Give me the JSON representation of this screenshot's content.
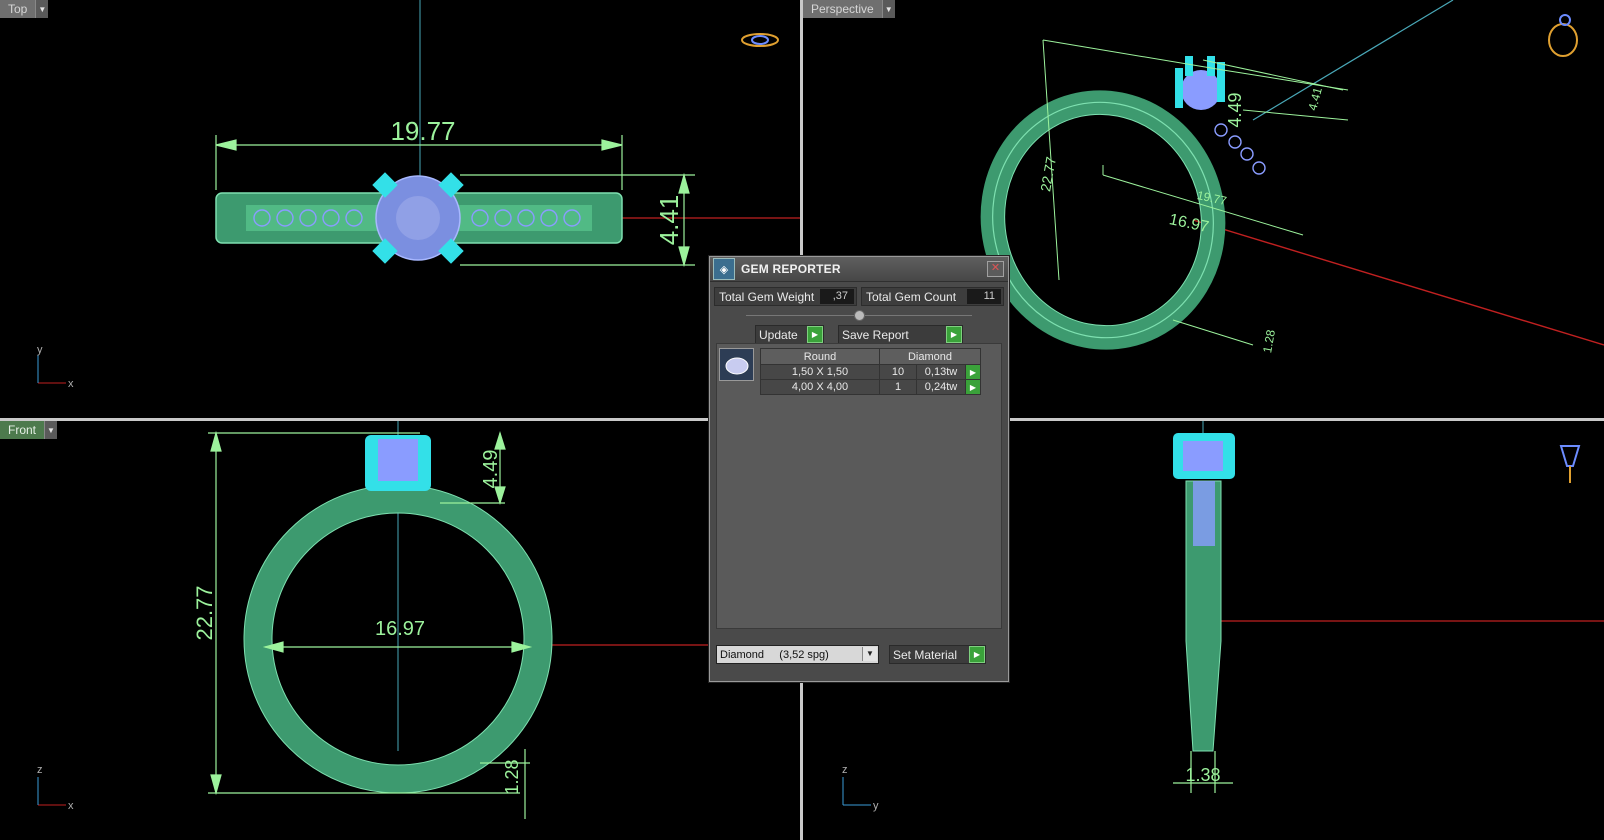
{
  "viewports": {
    "top": {
      "label": "Top",
      "dim_width": "19.77",
      "dim_height": "4.41",
      "axis_v": "y",
      "axis_h": "x"
    },
    "perspective": {
      "label": "Perspective",
      "dim_height": "22.77",
      "dim_prong": "4.49",
      "dim_top": "4.41",
      "dim_width": "19.77",
      "dim_inner": "16.97",
      "dim_band": "1.28"
    },
    "front": {
      "label": "Front",
      "dim_height": "22.77",
      "dim_prong": "4.49",
      "dim_inner": "16.97",
      "dim_band": "1.28",
      "axis_v": "z",
      "axis_h": "x"
    },
    "right": {
      "dim_band": "1.38",
      "axis_v": "z",
      "axis_h": "y"
    }
  },
  "gem_reporter": {
    "title": "GEM REPORTER",
    "total_weight_label": "Total Gem Weight",
    "total_weight_value": ",37",
    "total_count_label": "Total Gem Count",
    "total_count_value": "11",
    "update_label": "Update",
    "save_report_label": "Save Report",
    "table": {
      "headers": [
        "Round",
        "Diamond"
      ],
      "rows": [
        {
          "size": "1,50 X 1,50",
          "count": "10",
          "weight": "0,13tw"
        },
        {
          "size": "4,00 X 4,00",
          "count": "1",
          "weight": "0,24tw"
        }
      ]
    },
    "material_select_value": "Diamond     (3,52 spg)",
    "set_material_label": "Set Material"
  },
  "colors": {
    "metal": "#4fbf8a",
    "gem": "#8899ff",
    "dimension": "#9cf29c",
    "prong": "#33e0e8"
  }
}
